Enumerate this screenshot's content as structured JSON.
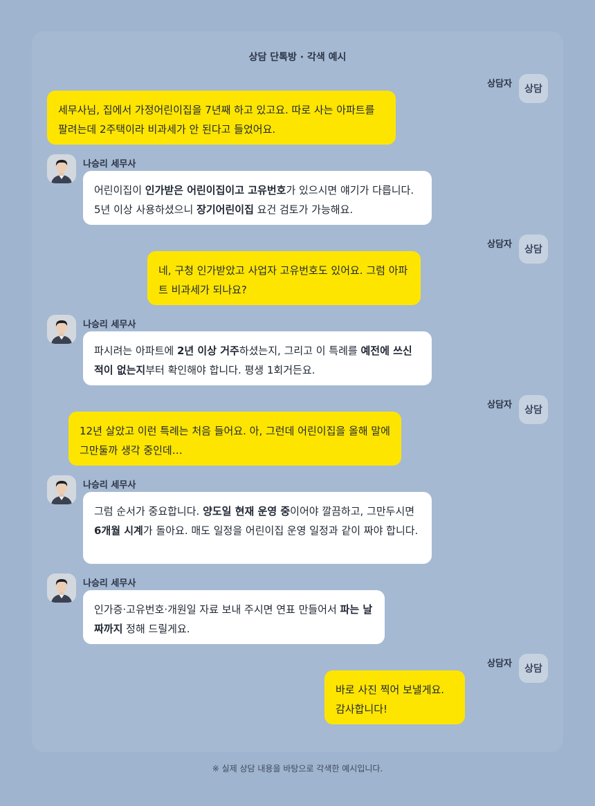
{
  "header": {
    "title": "상담 단톡방 · 각색 예시"
  },
  "consultant": {
    "name": "상담자",
    "avatar_label": "상담"
  },
  "tax_accountant": {
    "name": "나승리 세무사"
  },
  "messages": [
    {
      "from": "consultant",
      "segments": [
        {
          "t": "세무사님, 집에서 가정어린이집을 7년째 하고 있고요. 따로 사는 아파트를 팔려는데 2주택이라 비과세가 안 된다고 들었어요.",
          "b": false
        }
      ]
    },
    {
      "from": "tax",
      "segments": [
        {
          "t": "어린이집이 ",
          "b": false
        },
        {
          "t": "인가받은 어린이집이고 고유번호",
          "b": true
        },
        {
          "t": "가 있으시면 얘기가 다릅니다. 5년 이상 사용하셨으니 ",
          "b": false
        },
        {
          "t": "장기어린이집",
          "b": true
        },
        {
          "t": " 요건 검토가 가능해요.",
          "b": false
        }
      ]
    },
    {
      "from": "consultant",
      "segments": [
        {
          "t": "네, 구청 인가받았고 사업자 고유번호도 있어요. 그럼 아파트 비과세가 되나요?",
          "b": false
        }
      ]
    },
    {
      "from": "tax",
      "segments": [
        {
          "t": "파시려는 아파트에 ",
          "b": false
        },
        {
          "t": "2년 이상 거주",
          "b": true
        },
        {
          "t": "하셨는지, 그리고 이 특례를 ",
          "b": false
        },
        {
          "t": "예전에 쓰신 적이 없는지",
          "b": true
        },
        {
          "t": "부터 확인해야 합니다. 평생 1회거든요.",
          "b": false
        }
      ]
    },
    {
      "from": "consultant",
      "segments": [
        {
          "t": "12년 살았고 이런 특례는 처음 들어요. 아, 그런데 어린이집을 올해 말에 그만둘까 생각 중인데…",
          "b": false
        }
      ]
    },
    {
      "from": "tax",
      "segments": [
        {
          "t": "그럼 순서가 중요합니다. ",
          "b": false
        },
        {
          "t": "양도일 현재 운영 중",
          "b": true
        },
        {
          "t": "이어야 깔끔하고, 그만두시면 ",
          "b": false
        },
        {
          "t": "6개월 시계",
          "b": true
        },
        {
          "t": "가 돌아요. 매도 일정을 어린이집 운영 일정과 같이 짜야 합니다.",
          "b": false
        }
      ]
    },
    {
      "from": "tax",
      "segments": [
        {
          "t": "인가증·고유번호·개원일 자료 보내 주시면 연표 만들어서 ",
          "b": false
        },
        {
          "t": "파는 날짜까지",
          "b": true
        },
        {
          "t": " 정해 드릴게요.",
          "b": false
        }
      ]
    },
    {
      "from": "consultant",
      "segments": [
        {
          "t": "바로 사진 찍어 보낼게요.\n감사합니다!",
          "b": false
        }
      ]
    }
  ],
  "footer": {
    "note": "※ 실제 상담 내용을 바탕으로 각색한 예시입니다."
  }
}
